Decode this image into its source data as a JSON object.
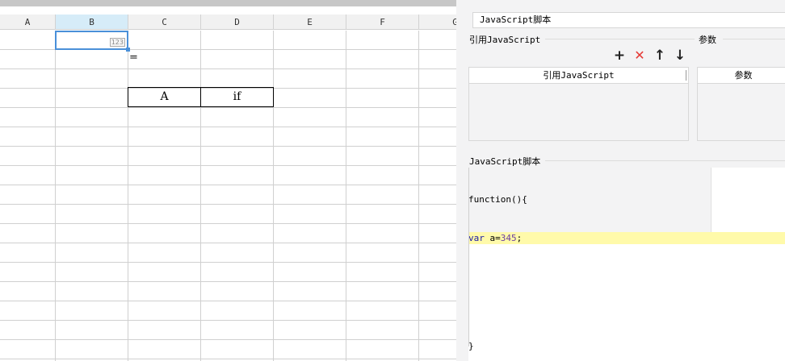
{
  "spreadsheet": {
    "columns": [
      "A",
      "B",
      "C",
      "D",
      "E",
      "F",
      "G"
    ],
    "selected_column": "B",
    "selected_cell_badge": "123",
    "cell_c2": "=",
    "boxed_cells": [
      "A",
      "if"
    ]
  },
  "panel": {
    "script_name": "JavaScript脚本",
    "ref_group_title": "引用JavaScript",
    "param_group_title": "参数",
    "toolbar": {
      "add_icon": "+",
      "delete_icon": "✕",
      "up_icon": "↑",
      "down_icon": "↓"
    },
    "ref_list_header": "引用JavaScript",
    "param_list_header": "参数",
    "script_group_title": "JavaScript脚本",
    "code": {
      "line1": "function(){",
      "line2_kw": "var",
      "line2_mid": " a=",
      "line2_num": "345",
      "line2_end": ";",
      "closing": "}"
    }
  },
  "colors": {
    "selection_blue": "#4a90d9",
    "delete_red": "#e53935",
    "highlight_line": "#fffaaa"
  }
}
